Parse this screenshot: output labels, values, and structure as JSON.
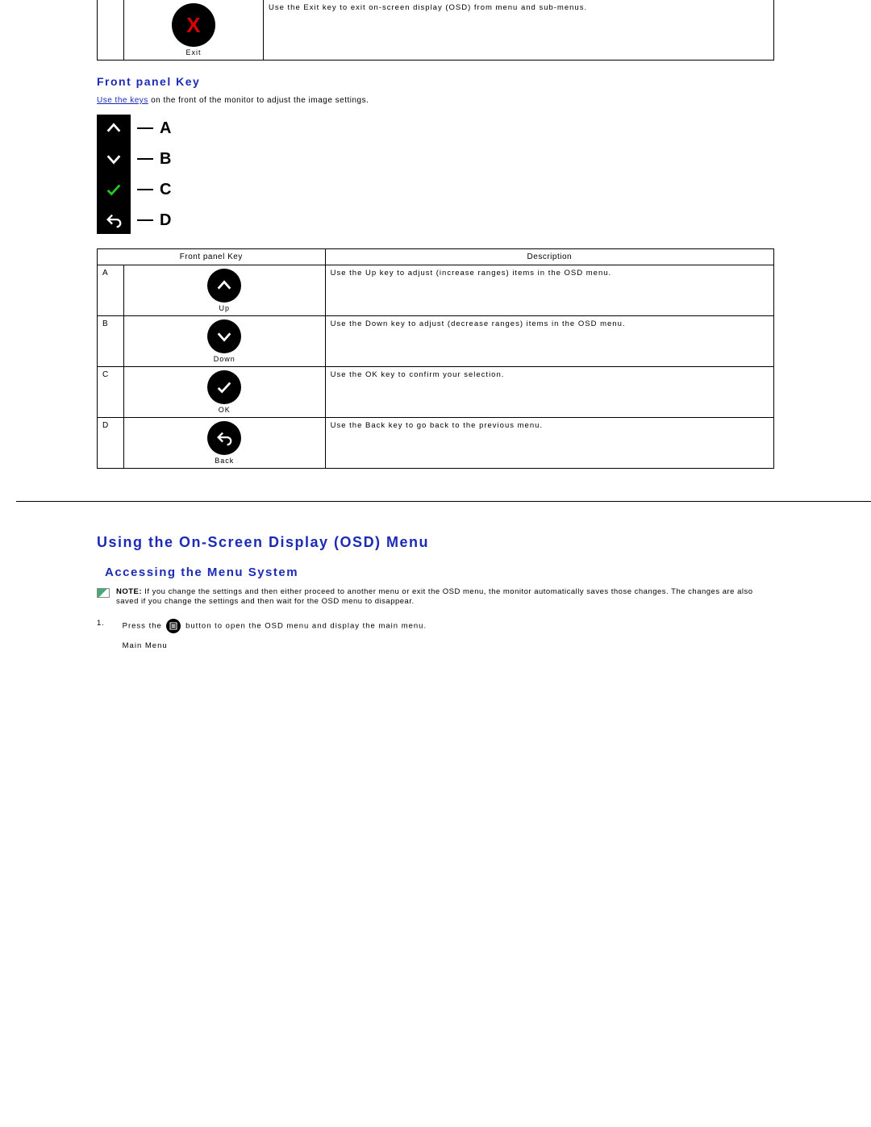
{
  "top_row": {
    "icon_label": "Exit",
    "description": "Use the Exit key to exit on-screen display (OSD) from menu and sub-menus."
  },
  "section1": {
    "heading": "Front panel Key",
    "link_text": "Use the keys",
    "after_link": " on the front of the monitor to adjust the image settings."
  },
  "panel_labels": {
    "a": "A",
    "b": "B",
    "c": "C",
    "d": "D"
  },
  "table": {
    "header_key": "Front panel Key",
    "header_desc": "Description",
    "rows": [
      {
        "id": "A",
        "label": "Up",
        "desc": "Use the Up key to adjust (increase ranges) items in the OSD menu."
      },
      {
        "id": "B",
        "label": "Down",
        "desc": "Use the Down key to adjust (decrease ranges) items in the OSD menu."
      },
      {
        "id": "C",
        "label": "OK",
        "desc": "Use the OK key to confirm your selection."
      },
      {
        "id": "D",
        "label": "Back",
        "desc": "Use the Back key to go back to the previous menu."
      }
    ]
  },
  "section2": {
    "heading": "Using the On-Screen Display (OSD) Menu",
    "sub_heading": "Accessing the Menu System",
    "note_prefix": "NOTE: ",
    "note_text": "If you change the settings and then either proceed to another menu or exit the OSD menu, the monitor automatically saves those changes. The changes are also saved if you change the settings and then wait for the OSD menu to disappear.",
    "step1_num": "1.",
    "step1_before": "Press the ",
    "step1_after": " button to open the OSD menu and display the main menu.",
    "main_menu_label": "Main Menu"
  }
}
